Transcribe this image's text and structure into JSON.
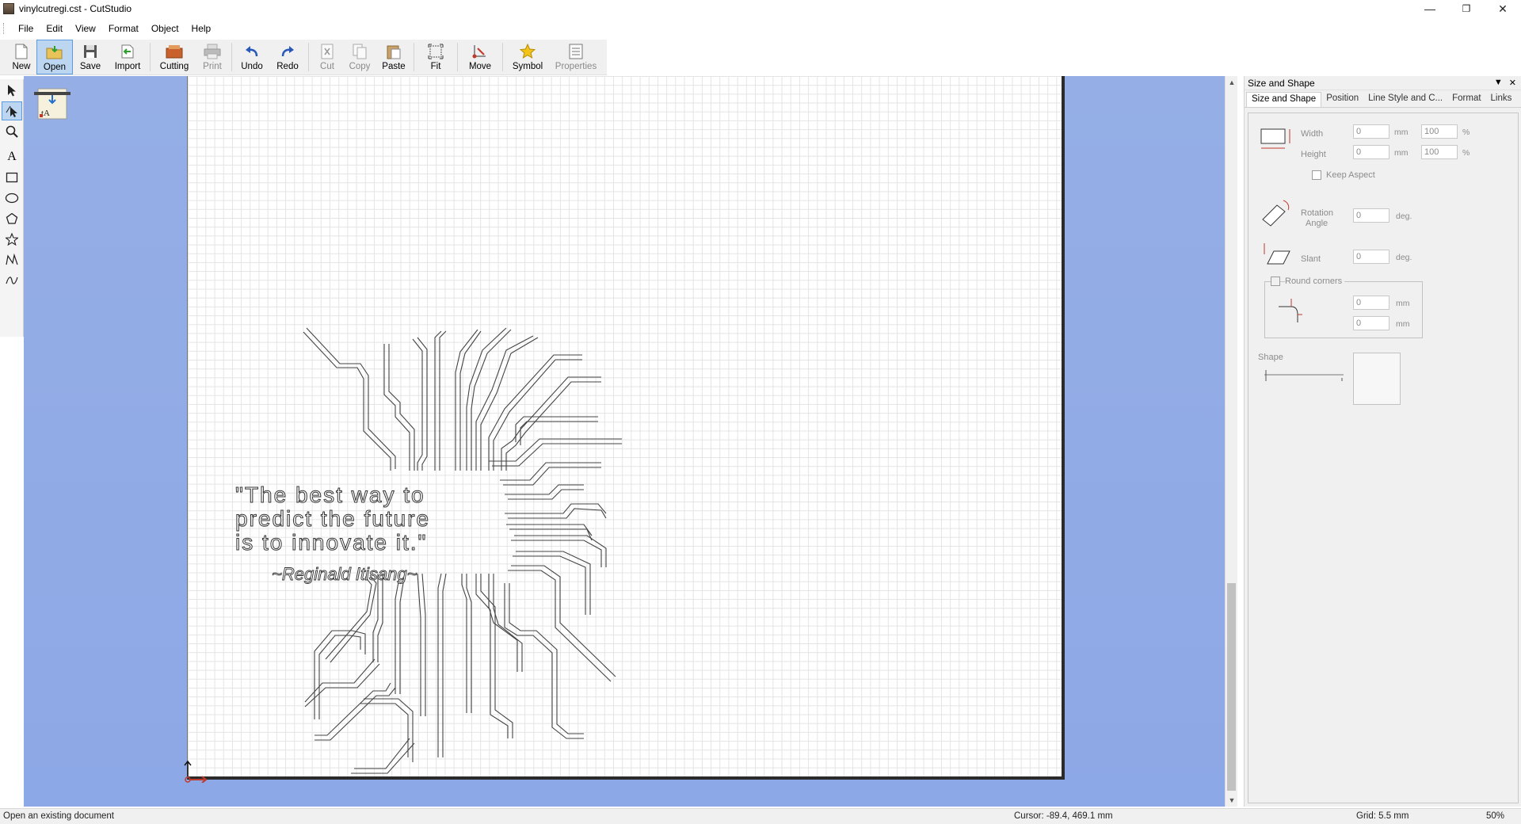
{
  "window": {
    "title": "vinylcutregi.cst - CutStudio",
    "controls": [
      "minimize-icon",
      "restore-icon",
      "close-icon"
    ]
  },
  "menu": [
    "File",
    "Edit",
    "View",
    "Format",
    "Object",
    "Help"
  ],
  "toolbar": [
    {
      "label": "New",
      "icon": "new-document-icon",
      "enabled": true
    },
    {
      "label": "Open",
      "icon": "open-folder-icon",
      "enabled": true,
      "active": true
    },
    {
      "label": "Save",
      "icon": "floppy-save-icon",
      "enabled": true
    },
    {
      "label": "Import",
      "icon": "import-icon",
      "enabled": true
    },
    {
      "label": "Cutting",
      "icon": "cutter-icon",
      "enabled": true
    },
    {
      "label": "Print",
      "icon": "printer-icon",
      "enabled": false
    },
    {
      "label": "Undo",
      "icon": "undo-icon",
      "enabled": true
    },
    {
      "label": "Redo",
      "icon": "redo-icon",
      "enabled": true
    },
    {
      "label": "Cut",
      "icon": "scissors-icon",
      "enabled": false
    },
    {
      "label": "Copy",
      "icon": "copy-icon",
      "enabled": false
    },
    {
      "label": "Paste",
      "icon": "paste-icon",
      "enabled": true
    },
    {
      "label": "Fit",
      "icon": "fit-icon",
      "enabled": true
    },
    {
      "label": "Move",
      "icon": "move-icon",
      "enabled": true
    },
    {
      "label": "Symbol",
      "icon": "star-symbol-icon",
      "enabled": true
    },
    {
      "label": "Properties",
      "icon": "properties-icon",
      "enabled": false
    }
  ],
  "tools": [
    "select-arrow-icon",
    "edit-points-icon",
    "zoom-icon",
    "text-icon",
    "rectangle-icon",
    "ellipse-icon",
    "polygon-icon",
    "star-icon",
    "polyline-icon",
    "curve-icon"
  ],
  "artwork": {
    "quote_lines": [
      "\"The best way to",
      "predict the future",
      "is to innovate  it.\""
    ],
    "author": "~Reginald Itisang~"
  },
  "panel": {
    "title": "Size and Shape",
    "tabs": [
      "Size and Shape",
      "Position",
      "Line Style and C...",
      "Format",
      "Links"
    ],
    "width_label": "Width",
    "height_label": "Height",
    "width_value": "0",
    "height_value": "0",
    "width_pct": "100",
    "height_pct": "100",
    "unit_mm": "mm",
    "unit_pct": "%",
    "keep_aspect": "Keep Aspect",
    "rotation_label_1": "Rotation",
    "rotation_label_2": "Angle",
    "rotation_value": "0",
    "unit_deg": "deg.",
    "slant_label": "Slant",
    "slant_value": "0",
    "round_corners": "Round corners",
    "corner_value_1": "0",
    "corner_value_2": "0",
    "shape_label": "Shape"
  },
  "status": {
    "message": "Open an existing document",
    "cursor": "Cursor: -89.4, 469.1 mm",
    "grid": "Grid: 5.5 mm",
    "zoom": "50%"
  },
  "colors": {
    "workspace": "#8fa9e6",
    "accent": "#5c9ae0"
  }
}
